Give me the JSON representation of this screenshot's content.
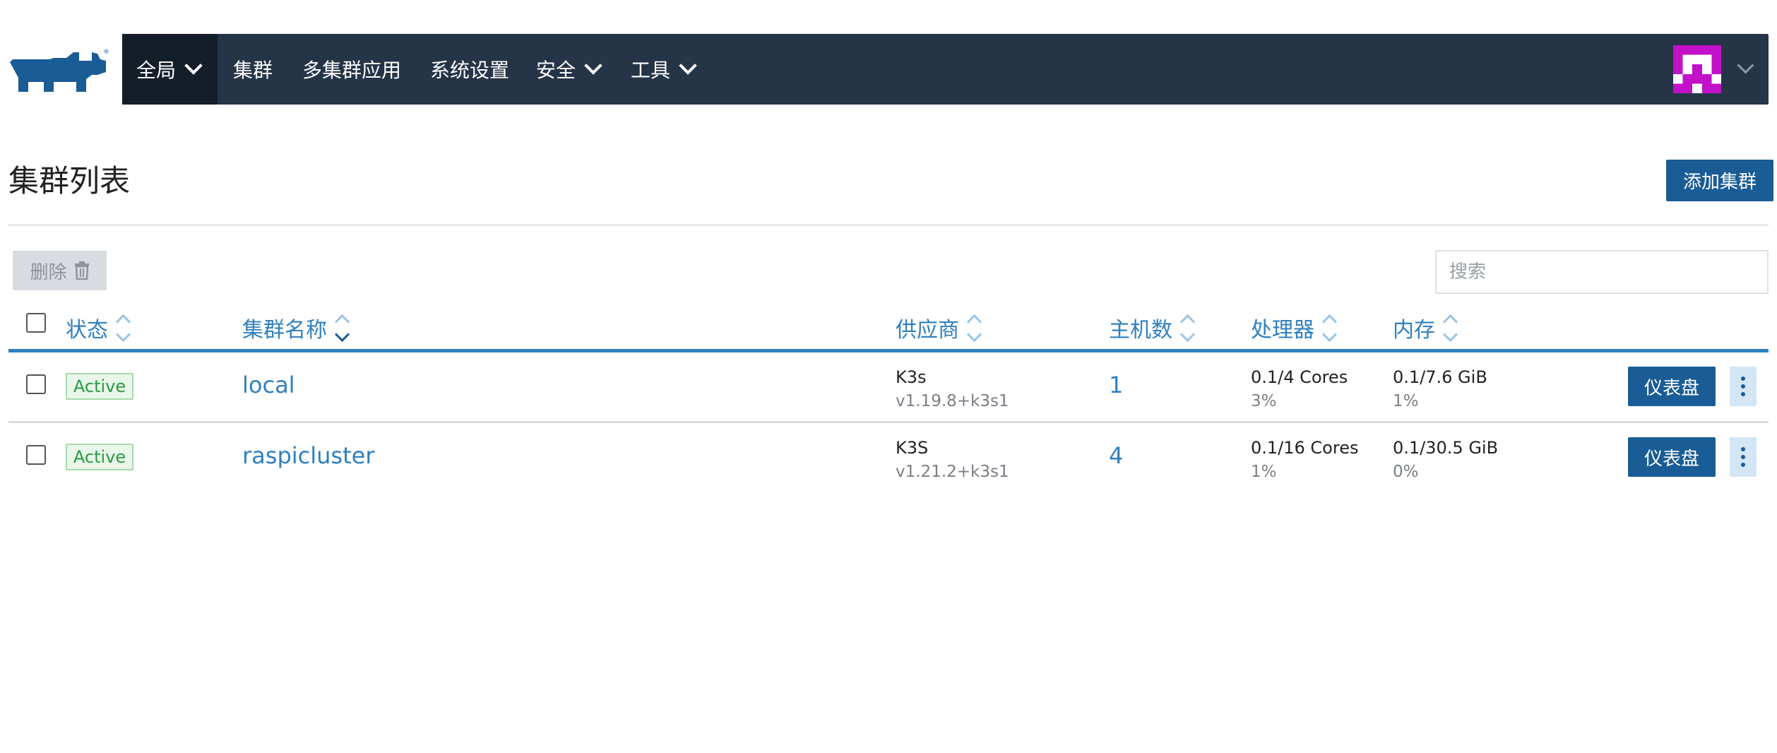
{
  "nav": {
    "items": [
      {
        "label": "全局",
        "dropdown": true,
        "active": true
      },
      {
        "label": "集群",
        "dropdown": false
      },
      {
        "label": "多集群应用",
        "dropdown": false
      },
      {
        "label": "系统设置",
        "dropdown": false
      },
      {
        "label": "安全",
        "dropdown": true
      },
      {
        "label": "工具",
        "dropdown": true
      }
    ]
  },
  "page": {
    "title": "集群列表",
    "add_button": "添加集群",
    "delete_button": "删除",
    "search_placeholder": "搜索"
  },
  "table": {
    "columns": [
      "状态",
      "集群名称",
      "供应商",
      "主机数",
      "处理器",
      "内存"
    ],
    "rows": [
      {
        "state": "Active",
        "name": "local",
        "provider": "K3s",
        "version": "v1.19.8+k3s1",
        "hosts": "1",
        "cpu": "0.1/4 Cores",
        "cpu_pct": "3%",
        "memory": "0.1/7.6 GiB",
        "memory_pct": "1%",
        "action": "仪表盘"
      },
      {
        "state": "Active",
        "name": "raspicluster",
        "provider": "K3S",
        "version": "v1.21.2+k3s1",
        "hosts": "4",
        "cpu": "0.1/16 Cores",
        "cpu_pct": "1%",
        "memory": "0.1/30.5 GiB",
        "memory_pct": "0%",
        "action": "仪表盘"
      }
    ]
  },
  "colors": {
    "nav_bg": "#253447",
    "nav_active": "#141e29",
    "primary": "#1a5c96",
    "link": "#2f80c0",
    "active_badge": "#2c9a40"
  },
  "icons": {
    "logo": "rancher-logo",
    "delete": "trash-icon",
    "avatar": "identicon-avatar"
  }
}
